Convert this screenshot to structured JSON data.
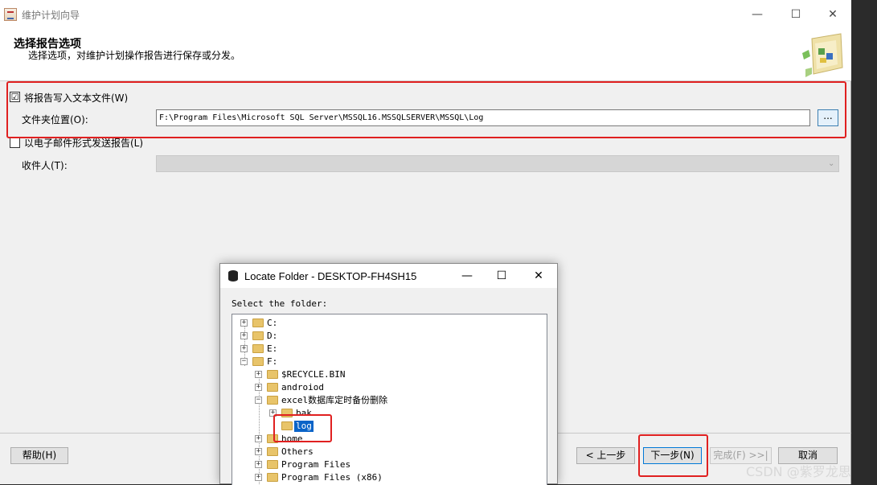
{
  "window": {
    "title": "维护计划向导",
    "minimize_glyph": "—",
    "maximize_glyph": "☐",
    "close_glyph": "✕"
  },
  "header": {
    "title": "选择报告选项",
    "subtitle": "选择选项，对维护计划操作报告进行保存或分发。",
    "image_icon": "wizard-graphic-icon"
  },
  "options": {
    "write_text_file": {
      "label": "将报告写入文本文件(W)",
      "checked": true,
      "mark": "☑"
    },
    "folder_label": "文件夹位置(O):",
    "folder_value": "F:\\Program Files\\Microsoft SQL Server\\MSSQL16.MSSQLSERVER\\MSSQL\\Log",
    "browse_label": "...",
    "email": {
      "label": "以电子邮件形式发送报告(L)",
      "checked": false
    },
    "recipient_label": "收件人(T):",
    "recipient_value": ""
  },
  "footer": {
    "help": "帮助(H)",
    "back": "< 上一步",
    "next": "下一步(N)",
    "finish": "完成(F) >>|",
    "cancel": "取消"
  },
  "dialog": {
    "title": "Locate Folder - DESKTOP-FH4SH15",
    "select_label": "Select the folder:",
    "tree": [
      {
        "label": "C:",
        "expander": "+"
      },
      {
        "label": "D:",
        "expander": "+"
      },
      {
        "label": "E:",
        "expander": "+"
      },
      {
        "label": "F:",
        "expander": "−"
      },
      {
        "label": "$RECYCLE.BIN",
        "expander": "+"
      },
      {
        "label": "androiod",
        "expander": "+"
      },
      {
        "label": "excel数据库定时备份删除",
        "expander": "−"
      },
      {
        "label": "bak",
        "expander": "+"
      },
      {
        "label": "log",
        "expander": "",
        "selected": true
      },
      {
        "label": "home",
        "expander": "+"
      },
      {
        "label": "Others",
        "expander": "+"
      },
      {
        "label": "Program Files",
        "expander": "+"
      },
      {
        "label": "Program Files (x86)",
        "expander": "+"
      }
    ]
  },
  "watermark": "CSDN @紫罗龙思",
  "colors": {
    "highlight_box": "#e02020",
    "selection": "#0a64c8",
    "folder": "#e8c46a"
  }
}
